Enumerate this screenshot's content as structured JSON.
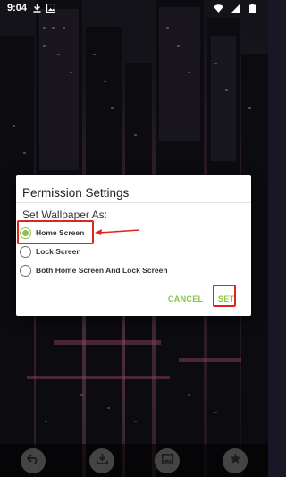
{
  "status_bar": {
    "time": "9:04",
    "icons_left": [
      "download-icon",
      "photo-icon"
    ],
    "icons_right": [
      "wifi-icon",
      "signal-icon",
      "battery-icon"
    ]
  },
  "dialog": {
    "title": "Permission Settings",
    "subtitle": "Set Wallpaper As:",
    "options": [
      {
        "label": "Home Screen",
        "selected": true
      },
      {
        "label": "Lock Screen",
        "selected": false
      },
      {
        "label": "Both Home Screen And Lock Screen",
        "selected": false
      }
    ],
    "cancel_label": "CANCEL",
    "set_label": "SET"
  },
  "toolbar": {
    "buttons": [
      "undo-icon",
      "download-icon",
      "gallery-icon",
      "star-icon"
    ]
  },
  "colors": {
    "accent": "#8bc34a",
    "annotation": "#e0251f"
  }
}
